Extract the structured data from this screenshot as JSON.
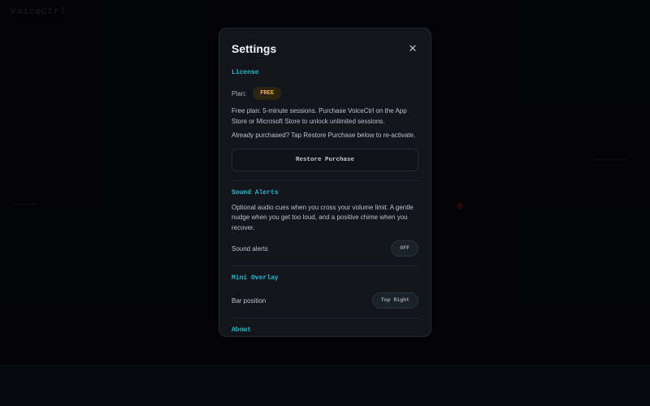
{
  "app": {
    "title": "VoiceCtrl"
  },
  "colors": {
    "accent": "#22b7c9",
    "badge": "#f0b429",
    "modal_bg": "#12161c"
  },
  "modal": {
    "title": "Settings",
    "close_icon": "close-icon",
    "close_glyph": "✕"
  },
  "license": {
    "section_label": "License",
    "plan_label": "Plan:",
    "plan_value": "FREE",
    "description": "Free plan: 5-minute sessions. Purchase VoiceCtrl on the App Store or Microsoft Store to unlock unlimited sessions.",
    "restore_hint": "Already purchased? Tap Restore Purchase below to re-activate.",
    "restore_button": "Restore Purchase"
  },
  "sound_alerts": {
    "section_label": "Sound Alerts",
    "description": "Optional audio cues when you cross your volume limit. A gentle nudge when you get too loud, and a positive chime when you recover.",
    "toggle_label": "Sound alerts",
    "toggle_value": "OFF"
  },
  "mini_overlay": {
    "section_label": "Mini Overlay",
    "position_label": "Bar position",
    "position_value": "Top Right"
  },
  "about": {
    "section_label": "About"
  }
}
